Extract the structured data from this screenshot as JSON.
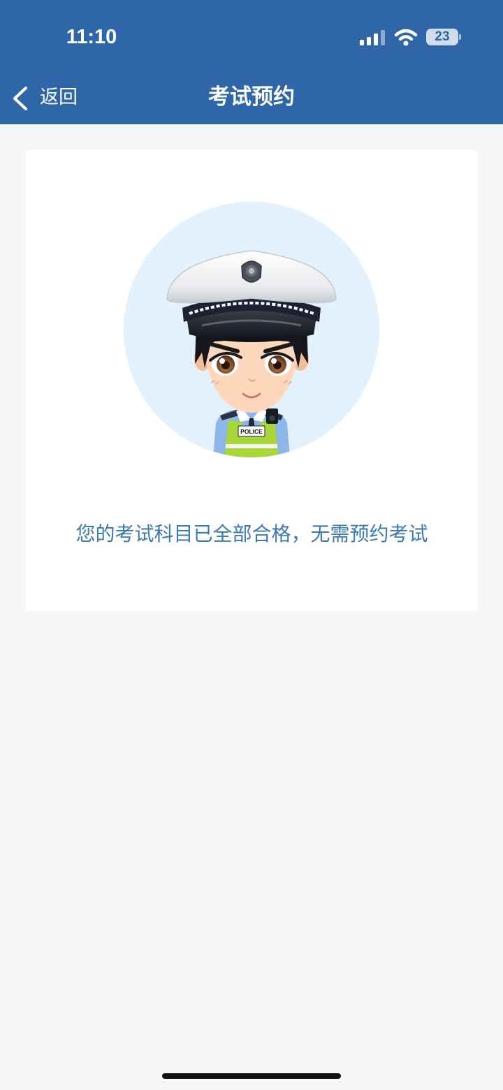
{
  "status_bar": {
    "time": "11:10",
    "battery_level": "23",
    "signal_icon": "cellular-signal-icon",
    "wifi_icon": "wifi-icon",
    "battery_icon": "battery-icon"
  },
  "nav": {
    "back_icon": "chevron-left-icon",
    "back_label": "返回",
    "title": "考试预约"
  },
  "content": {
    "illustration": {
      "subject": "police-officer-avatar",
      "vest_label": "POLICE"
    },
    "message": "您的考试科目已全部合格，无需预约考试"
  },
  "colors": {
    "header_bg": "#2E66A8",
    "page_bg": "#F5F6F7",
    "card_bg": "#FFFFFF",
    "message_text": "#3B79B5",
    "avatar_circle": "#E3F1FD"
  }
}
